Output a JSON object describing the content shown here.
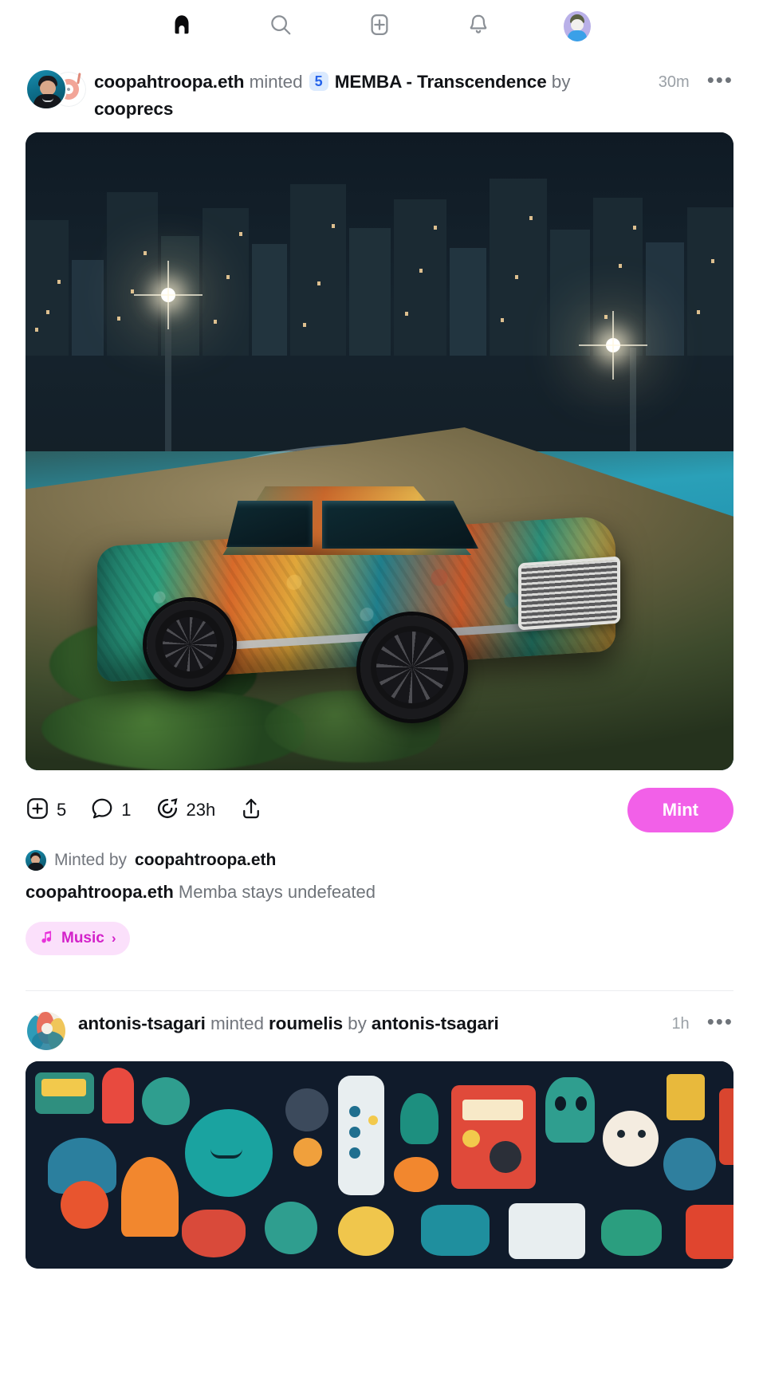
{
  "nav": {
    "items": [
      {
        "name": "home",
        "icon": "home-icon",
        "active": true
      },
      {
        "name": "search",
        "icon": "search-icon",
        "active": false
      },
      {
        "name": "create",
        "icon": "plus-square-icon",
        "active": false
      },
      {
        "name": "notifications",
        "icon": "bell-icon",
        "active": false
      },
      {
        "name": "profile",
        "icon": "avatar-icon",
        "active": false
      }
    ]
  },
  "posts": [
    {
      "actor": "coopahtroopa.eth",
      "verb": "minted",
      "count": "5",
      "item": "MEMBA - Transcendence",
      "by": "by",
      "creator": "cooprecs",
      "timestamp": "30m",
      "more": "•••",
      "actions": {
        "mint_count": "5",
        "comment_count": "1",
        "time_left": "23h",
        "share_label": "",
        "mint_button": "Mint"
      },
      "minted_by_label": "Minted by",
      "minted_by_user": "coopahtroopa.eth",
      "caption_user": "coopahtroopa.eth",
      "caption_text": "Memba stays undefeated",
      "tag": {
        "label": "Music",
        "chevron": "›",
        "icon": "music-note-icon"
      }
    },
    {
      "actor": "antonis-tsagari",
      "verb": "minted",
      "count": "",
      "item": "roumelis",
      "by": "by",
      "creator": "antonis-tsagari",
      "timestamp": "1h",
      "more": "•••"
    }
  ],
  "colors": {
    "accent_mint": "#f260e8",
    "badge_bg": "#dbeafe",
    "badge_text": "#2563eb",
    "tag_bg": "#fbe0fb",
    "tag_text": "#d321c9",
    "muted_text": "#72767d",
    "primary_text": "#111317"
  }
}
